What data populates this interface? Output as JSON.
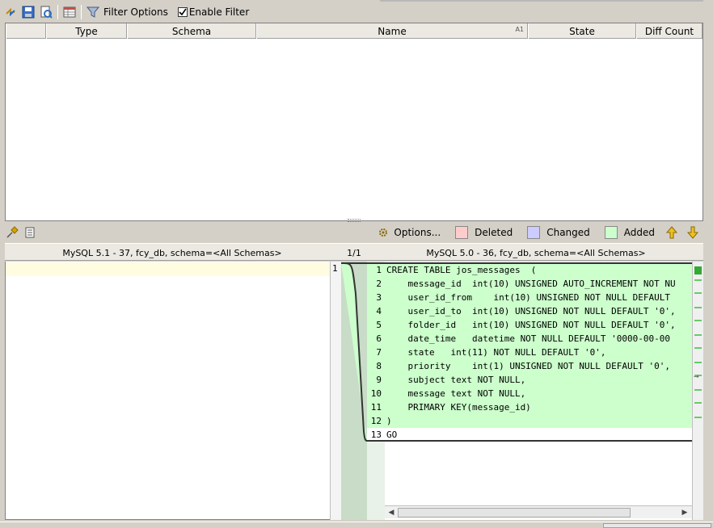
{
  "toolbar": {
    "filter_options_label": "Filter Options",
    "enable_filter_label": "Enable Filter",
    "enable_filter_checked": true
  },
  "table": {
    "columns": [
      "",
      "Type",
      "Schema",
      "Name",
      "State",
      "Diff Count"
    ],
    "sort_indicator": "A1"
  },
  "diff_toolbar": {
    "options_label": "Options...",
    "legend": [
      {
        "label": "Deleted",
        "color": "#ffcccc"
      },
      {
        "label": "Changed",
        "color": "#ccccff"
      },
      {
        "label": "Added",
        "color": "#ccffcc"
      }
    ]
  },
  "diff": {
    "left_header": "MySQL 5.1 - 37, fcy_db,  schema=<All Schemas>",
    "middle_header": "1/1",
    "right_header": "MySQL 5.0 - 36, fcy_db,  schema=<All Schemas>",
    "left_line_number": "1",
    "right_lines": [
      {
        "n": "1",
        "text": "CREATE TABLE jos_messages  ("
      },
      {
        "n": "2",
        "text": "    message_id  int(10) UNSIGNED AUTO_INCREMENT NOT NU"
      },
      {
        "n": "3",
        "text": "    user_id_from    int(10) UNSIGNED NOT NULL DEFAULT"
      },
      {
        "n": "4",
        "text": "    user_id_to  int(10) UNSIGNED NOT NULL DEFAULT '0',"
      },
      {
        "n": "5",
        "text": "    folder_id   int(10) UNSIGNED NOT NULL DEFAULT '0',"
      },
      {
        "n": "6",
        "text": "    date_time   datetime NOT NULL DEFAULT '0000-00-00"
      },
      {
        "n": "7",
        "text": "    state   int(11) NOT NULL DEFAULT '0',"
      },
      {
        "n": "8",
        "text": "    priority    int(1) UNSIGNED NOT NULL DEFAULT '0',"
      },
      {
        "n": "9",
        "text": "    subject text NOT NULL,"
      },
      {
        "n": "10",
        "text": "    message text NOT NULL,"
      },
      {
        "n": "11",
        "text": "    PRIMARY KEY(message_id)"
      },
      {
        "n": "12",
        "text": ")"
      },
      {
        "n": "13",
        "text": "GO"
      }
    ],
    "added_color": "#ccffcc"
  }
}
